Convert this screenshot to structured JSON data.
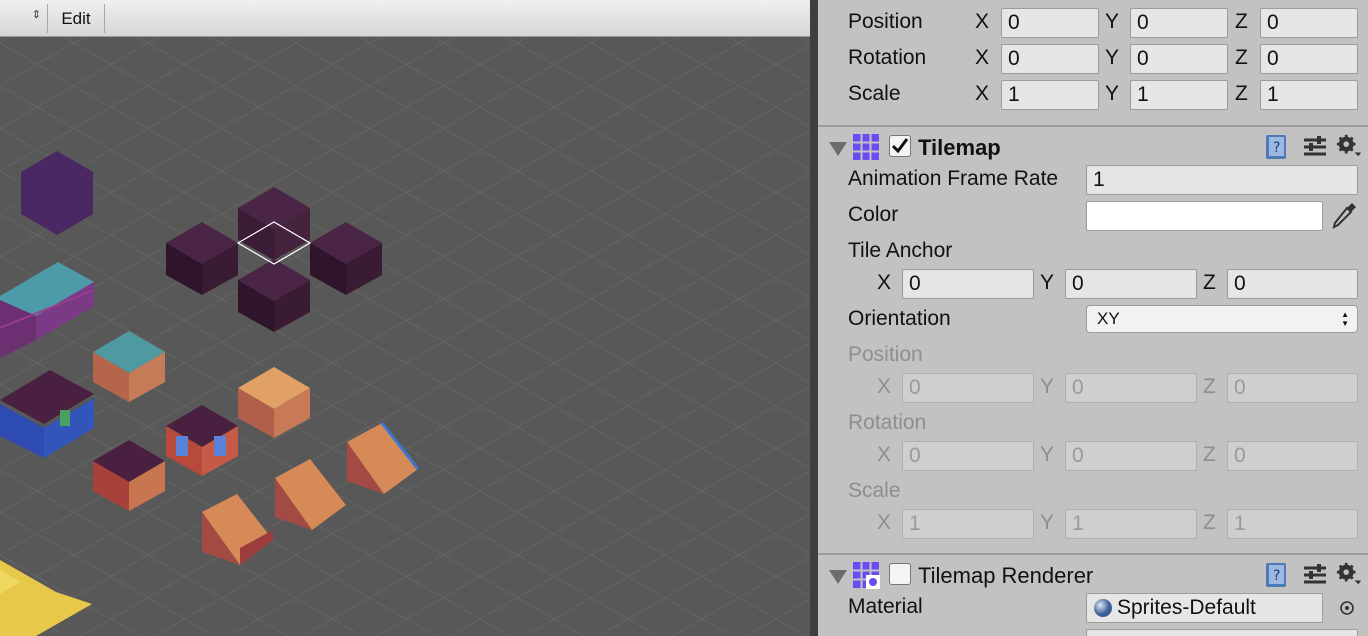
{
  "scene": {
    "toolbar": {
      "arrows_glyph": "⇕",
      "edit_label": "Edit"
    }
  },
  "inspector": {
    "transform": {
      "rows": [
        {
          "label": "Position",
          "x": "0",
          "y": "0",
          "z": "0"
        },
        {
          "label": "Rotation",
          "x": "0",
          "y": "0",
          "z": "0"
        },
        {
          "label": "Scale",
          "x": "1",
          "y": "1",
          "z": "1"
        }
      ]
    },
    "axes": {
      "x": "X",
      "y": "Y",
      "z": "Z"
    },
    "tilemap": {
      "title": "Tilemap",
      "enabled": true,
      "animation_frame_rate_label": "Animation Frame Rate",
      "animation_frame_rate_value": "1",
      "color_label": "Color",
      "color_value": "#ffffff",
      "tile_anchor_label": "Tile Anchor",
      "tile_anchor": {
        "x": "0",
        "y": "0",
        "z": "0"
      },
      "orientation_label": "Orientation",
      "orientation_value": "XY",
      "position_label": "Position",
      "position": {
        "x": "0",
        "y": "0",
        "z": "0"
      },
      "rotation_label": "Rotation",
      "rotation": {
        "x": "0",
        "y": "0",
        "z": "0"
      },
      "scale_label": "Scale",
      "scale": {
        "x": "1",
        "y": "1",
        "z": "1"
      }
    },
    "tilemap_renderer": {
      "title": "Tilemap Renderer",
      "enabled": false,
      "material_label": "Material",
      "material_value": "Sprites-Default"
    },
    "icons": [
      "help-book-icon",
      "preset-sliders-icon",
      "gear-icon",
      "eyedropper-icon",
      "object-picker-icon",
      "grid-component-icon"
    ],
    "colors": {
      "accent_purple": "#6a4cf0",
      "panel_bg": "#c2c2c2",
      "field_bg": "#e6e6e6"
    }
  }
}
